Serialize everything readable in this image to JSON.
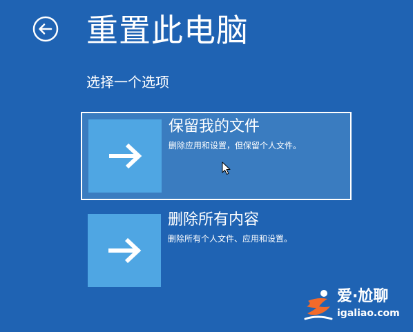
{
  "page": {
    "title": "重置此电脑",
    "subtitle": "选择一个选项"
  },
  "options": [
    {
      "title": "保留我的文件",
      "description": "删除应用和设置，但保留个人文件。",
      "icon": "arrow-right-icon",
      "selected": true
    },
    {
      "title": "删除所有内容",
      "description": "删除所有个人文件、应用和设置。",
      "icon": "arrow-right-icon",
      "selected": false
    }
  ],
  "watermark": {
    "brand": "爱·尬聊",
    "url": "igaliao.com"
  },
  "colors": {
    "background": "#1f63b3",
    "tile": "#4fa6e3",
    "selected_fill": "#3a7cc0",
    "text": "#ffffff",
    "watermark_accent": "#f26a2a"
  }
}
